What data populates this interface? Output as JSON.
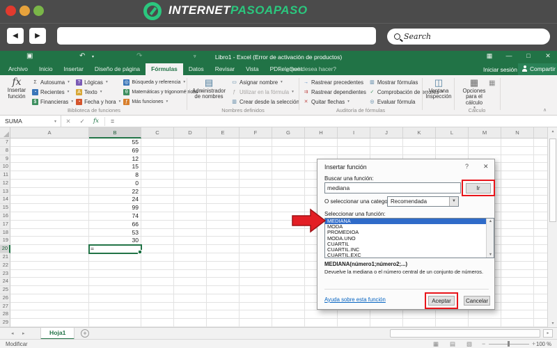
{
  "colors": {
    "excel_green": "#217346",
    "brand_green": "#2bc77e",
    "selection_blue": "#2f6bc9",
    "annotation_red": "#e8141a",
    "browser_bar": "#4b4b4b",
    "dot_red": "#e23a2e",
    "dot_orange": "#e6a23c",
    "dot_green": "#7ab648",
    "link_blue": "#0563c1"
  },
  "browser": {
    "brand_white": "INTERNET",
    "brand_green": "PASOAPASO",
    "search_placeholder": "Search"
  },
  "excel": {
    "titlebar": {
      "title": "Libro1 - Excel (Error de activación de productos)",
      "help_hint": "¿Qué desea hacer?",
      "signin": "Iniciar sesión",
      "share": "Compartir"
    },
    "tabs": [
      {
        "label": "Archivo",
        "active": false
      },
      {
        "label": "Inicio",
        "active": false
      },
      {
        "label": "Insertar",
        "active": false
      },
      {
        "label": "Diseño de página",
        "active": false
      },
      {
        "label": "Fórmulas",
        "active": true
      },
      {
        "label": "Datos",
        "active": false
      },
      {
        "label": "Revisar",
        "active": false
      },
      {
        "label": "Vista",
        "active": false
      },
      {
        "label": "PDFelement",
        "active": false
      }
    ],
    "ribbon": {
      "insert_function": "Insertar función",
      "library": {
        "label": "Biblioteca de funciones",
        "columns": [
          [
            {
              "glyph": "Σ",
              "fg": "#555",
              "bg": "",
              "label": "Autosuma",
              "caret": true
            },
            {
              "glyph": "◔",
              "fg": "#fff",
              "bg": "#3a76b9",
              "label": "Recientes",
              "caret": true
            },
            {
              "glyph": "$",
              "fg": "#fff",
              "bg": "#3d8f5f",
              "label": "Financieras",
              "caret": true
            }
          ],
          [
            {
              "glyph": "?",
              "fg": "#fff",
              "bg": "#7a5ab5",
              "label": "Lógicas",
              "caret": true
            },
            {
              "glyph": "A",
              "fg": "#fff",
              "bg": "#d8a838",
              "label": "Texto",
              "caret": true
            },
            {
              "glyph": "◔",
              "fg": "#fff",
              "bg": "#d4542c",
              "label": "Fecha y hora",
              "caret": true
            }
          ],
          [
            {
              "glyph": "◎",
              "fg": "#fff",
              "bg": "#3a76b9",
              "label": "Búsqueda y referencia",
              "caret": true
            },
            {
              "glyph": "θ",
              "fg": "#fff",
              "bg": "#3d8f5f",
              "label": "Matemáticas y trigonométricas",
              "caret": true
            },
            {
              "glyph": "ƒ",
              "fg": "#fff",
              "bg": "#d87f2c",
              "label": "Más funciones",
              "caret": true
            }
          ]
        ]
      },
      "names": {
        "label": "Nombres definidos",
        "big_button": "Administrador de nombres",
        "columns": [
          [
            {
              "glyph": "▭",
              "fg": "#4f7d9e",
              "bg": "",
              "label": "Asignar nombre",
              "caret": true
            },
            {
              "glyph": "ƒ",
              "fg": "#a6a4a2",
              "bg": "",
              "label": "Utilizar en la fórmula",
              "caret": true,
              "disabled": true
            },
            {
              "glyph": "▥",
              "fg": "#4f7d9e",
              "bg": "",
              "label": "Crear desde la selección",
              "caret": false
            }
          ]
        ]
      },
      "audit": {
        "label": "Auditoría de fórmulas",
        "columns": [
          [
            {
              "glyph": "→",
              "fg": "#3a76b9",
              "bg": "",
              "label": "Rastrear precedentes",
              "caret": false
            },
            {
              "glyph": "⇉",
              "fg": "#c2504e",
              "bg": "",
              "label": "Rastrear dependientes",
              "caret": false
            },
            {
              "glyph": "✕",
              "fg": "#c2504e",
              "bg": "",
              "label": "Quitar flechas",
              "caret": true
            }
          ],
          [
            {
              "glyph": "▥",
              "fg": "#4f7d9e",
              "bg": "",
              "label": "Mostrar fórmulas",
              "caret": false
            },
            {
              "glyph": "✓",
              "fg": "#3d8f5f",
              "bg": "",
              "label": "Comprobación de errores",
              "caret": true
            },
            {
              "glyph": "◎",
              "fg": "#4f7d9e",
              "bg": "",
              "label": "Evaluar fórmula",
              "caret": false
            }
          ]
        ]
      },
      "watch_window": "Ventana Inspección",
      "calc": {
        "label": "Cálculo",
        "button": "Opciones para el cálculo"
      }
    },
    "formula_bar": {
      "name_box": "SUMA",
      "formula": "="
    },
    "grid": {
      "columns": [
        "A",
        "B",
        "C",
        "D",
        "E",
        "F",
        "G",
        "H",
        "I",
        "J",
        "K",
        "L",
        "M",
        "N"
      ],
      "selected_column": "B",
      "row_start": 7,
      "row_end": 29,
      "active_row": 20,
      "cells": {
        "7": "55",
        "8": "69",
        "9": "12",
        "10": "15",
        "11": "8",
        "12": "0",
        "13": "22",
        "14": "24",
        "15": "99",
        "16": "74",
        "17": "66",
        "18": "53",
        "19": "30",
        "20": "="
      }
    },
    "sheet_bar": {
      "tab": "Hoja1"
    },
    "status_bar": {
      "mode": "Modificar",
      "zoom": "100 %"
    }
  },
  "dialog": {
    "title": "Insertar función",
    "search_label": "Buscar una función:",
    "search_value": "mediana",
    "go_button": "Ir",
    "category_label": "O seleccionar una categoría:",
    "category_value": "Recomendada",
    "select_label": "Seleccionar una función:",
    "functions": [
      "MEDIANA",
      "MODA",
      "PROMEDIOA",
      "MODA.UNO",
      "CUARTIL",
      "CUARTIL.INC",
      "CUARTIL.EXC"
    ],
    "selected_function": "MEDIANA",
    "signature": "MEDIANA(número1;número2;...)",
    "description": "Devuelve la mediana o el número central de un conjunto de números.",
    "help_link": "Ayuda sobre esta función",
    "ok": "Aceptar",
    "cancel": "Cancelar"
  }
}
